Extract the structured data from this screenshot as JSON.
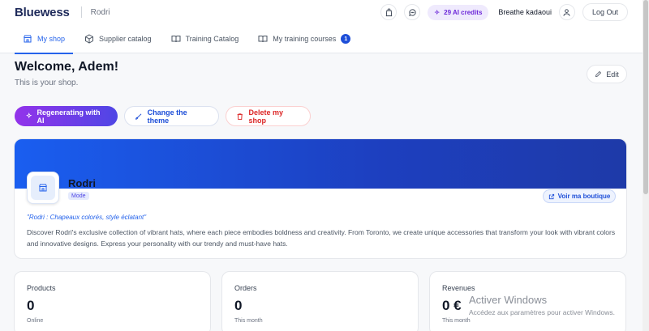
{
  "header": {
    "brand": "Bluewess",
    "shop_name": "Rodri",
    "credits": "29 AI credits",
    "user_name": "Breathe kadaoui",
    "logout": "Log Out"
  },
  "tabs": [
    {
      "label": "My shop",
      "icon": "store-icon",
      "active": true
    },
    {
      "label": "Supplier catalog",
      "icon": "cube-icon"
    },
    {
      "label": "Training Catalog",
      "icon": "book-icon"
    },
    {
      "label": "My training courses",
      "icon": "book-open-icon",
      "badge": "1"
    }
  ],
  "main": {
    "title": "Welcome, Adem!",
    "subtitle": "This is your shop.",
    "edit": "Edit",
    "actions": {
      "ai": "Regenerating with AI",
      "theme": "Change the theme",
      "delete": "Delete my shop"
    }
  },
  "shop_card": {
    "name": "Rodri",
    "category": "Mode",
    "visit": "Voir ma boutique",
    "tagline": "\"Rodri : Chapeaux colorés, style éclatant\"",
    "description": "Discover Rodri's exclusive collection of vibrant hats, where each piece embodies boldness and creativity. From Toronto, we create unique accessories that transform your look with vibrant colors and innovative designs. Express your personality with our trendy and must-have hats."
  },
  "stats": [
    {
      "label": "Products",
      "value": "0",
      "caption": "Online"
    },
    {
      "label": "Orders",
      "value": "0",
      "caption": "This month"
    },
    {
      "label": "Revenues",
      "value": "0 €",
      "caption": "This month"
    }
  ],
  "watermark": {
    "title": "Activer Windows",
    "subtitle": "Accédez aux paramètres pour activer Windows."
  },
  "colors": {
    "accent": "#2563eb",
    "banner": "#1d4ed8",
    "ai_gradient_start": "#9333ea",
    "danger": "#dc2626"
  }
}
